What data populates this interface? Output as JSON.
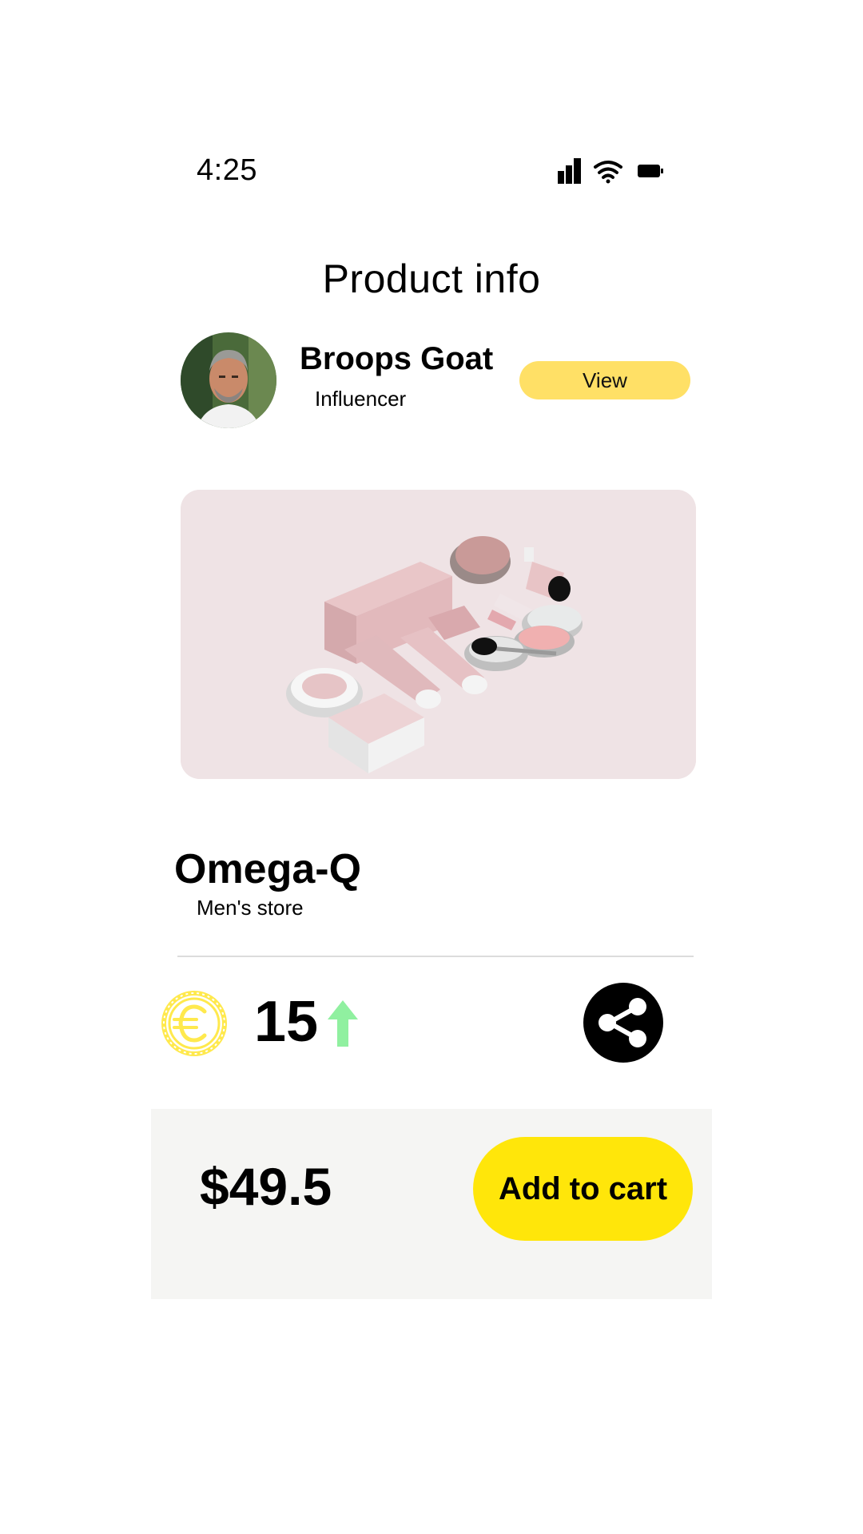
{
  "status_bar": {
    "time": "4:25",
    "icons": [
      "signal-icon",
      "wifi-icon",
      "battery-icon"
    ]
  },
  "header": {
    "title": "Product info"
  },
  "profile": {
    "name": "Broops Goat",
    "role": "Influencer",
    "view_label": "View",
    "avatar_icon": "avatar"
  },
  "product": {
    "image_icon": "product-image",
    "name": "Omega-Q",
    "store": "Men's store"
  },
  "points": {
    "currency_icon": "euro-coin-icon",
    "value": "15",
    "trend_icon": "arrow-up-icon",
    "trend_color": "#90f0a0",
    "share_icon": "share-icon"
  },
  "cart": {
    "price": "$49.5",
    "add_to_cart_label": "Add to cart"
  },
  "colors": {
    "accent_yellow": "#ffe60a",
    "view_yellow": "#ffe066",
    "coin_yellow": "#ffe94d",
    "panel_bg": "#f5f5f3"
  }
}
